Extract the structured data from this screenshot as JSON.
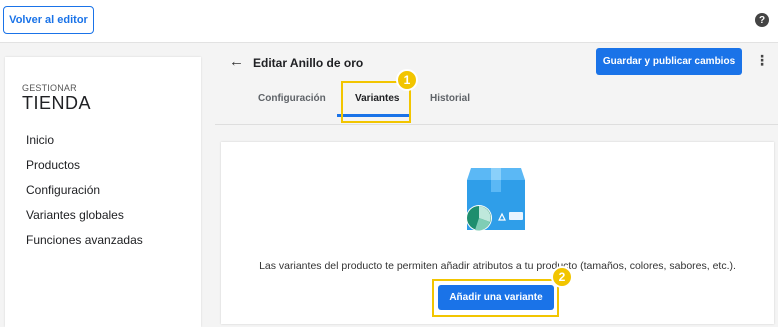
{
  "topbar": {
    "back_label": "Volver al editor",
    "help_glyph": "?"
  },
  "sidebar": {
    "caption": "GESTIONAR",
    "title": "TIENDA",
    "items": [
      {
        "label": "Inicio"
      },
      {
        "label": "Productos"
      },
      {
        "label": "Configuración"
      },
      {
        "label": "Variantes globales"
      },
      {
        "label": "Funciones avanzadas"
      }
    ]
  },
  "header": {
    "back_glyph": "←",
    "title": "Editar Anillo de oro",
    "publish_label": "Guardar y publicar cambios",
    "more_glyph": "⋮",
    "tabs": [
      {
        "label": "Configuración"
      },
      {
        "label": "Variantes"
      },
      {
        "label": "Historial"
      }
    ],
    "active_tab": "Variantes"
  },
  "callouts": [
    {
      "number": "1"
    },
    {
      "number": "2"
    }
  ],
  "main": {
    "illustration_icon": "product-box-icon",
    "description": "Las variantes del producto te permiten añadir atributos a tu producto (tamaños, colores, sabores, etc.).",
    "add_variant_label": "Añadir una variante"
  },
  "colors": {
    "accent": "#1a73e8",
    "callout": "#f2c500",
    "page_bg": "#f4f4f4"
  }
}
